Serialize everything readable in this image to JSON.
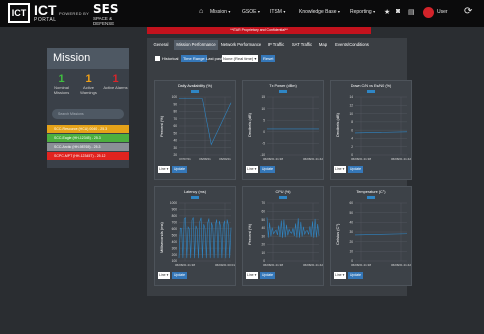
{
  "header": {
    "logo_box": "ICT",
    "logo_text": "ICT",
    "portal": "PORTAL",
    "powered_by": "POWERED BY",
    "ses": "SES",
    "ses_sub": "SPACE & DEFENSE",
    "nav": [
      "Mission",
      "GSOE",
      "ITSM",
      "Knowledge Base",
      "Reporting"
    ],
    "user": "User",
    "banner": "**ITAR Proprietary and Confidential**"
  },
  "mission": {
    "title": "Mission",
    "counts": [
      {
        "value": "1",
        "label": "Nominal Missions",
        "color": "#3fbf3f"
      },
      {
        "value": "1",
        "label": "Active Warnings",
        "color": "#f0a017"
      },
      {
        "value": "1",
        "label": "Active Alarms",
        "color": "#d9252b"
      }
    ],
    "search_placeholder": "Search Missions",
    "items": [
      {
        "label": "SCC-Resource (HCU) 0040 - 25.3",
        "color": "#e5a219"
      },
      {
        "label": "SCC-Eagle (HH-12345) - 25.3",
        "color": "#4caf3f"
      },
      {
        "label": "SCC-Arctic (HH-98765) - 25.3",
        "color": "#8a8f96"
      },
      {
        "label": "SCPC-MPT (HH-12345T) - 25.12",
        "color": "#e1231f"
      }
    ]
  },
  "tabs": [
    "General",
    "Mission Performance",
    "Network Performance",
    "IP Traffic",
    "SAT Traffic",
    "Map",
    "Events/Conditions"
  ],
  "active_tab": "Mission Performance",
  "controls": {
    "historical": "Historical",
    "time_range": "Time Range",
    "last_past": "Last past",
    "range_value": "None (Real time)",
    "reset": "Reset"
  },
  "panel_controls": {
    "select": "Line",
    "update": "Update"
  },
  "charts": [
    {
      "title": "Daily Availability (%)",
      "ylabel": "Percent (%)",
      "yticks": [
        "100",
        "90",
        "80",
        "70",
        "60",
        "50",
        "40",
        "30",
        "20"
      ],
      "xticks": [
        "07/07/21",
        "06/08/21",
        "06/09/21"
      ]
    },
    {
      "title": "Tx Power (dBm)",
      "ylabel": "Decibels (dB)",
      "yticks": [
        "15",
        "10",
        "5",
        "0",
        "-5",
        "-10"
      ],
      "xticks": [
        "06/08/21 21:38",
        "06/08/21 21:42"
      ]
    },
    {
      "title": "Down C/N vs Es/N0 (%)",
      "ylabel": "Decibels (dB)",
      "yticks": [
        "14",
        "12",
        "10",
        "8",
        "6",
        "4",
        "2",
        "0"
      ],
      "xticks": [
        "06/08/21 21:38",
        "06/08/21 21:42"
      ]
    },
    {
      "title": "Latency (ms)",
      "ylabel": "Milliseconds (ms)",
      "yticks": [
        "1000",
        "900",
        "800",
        "700",
        "600",
        "500",
        "400",
        "300",
        "200",
        "100"
      ],
      "xticks": [
        "06/08/21 21:38",
        "06/09/21 00:01"
      ]
    },
    {
      "title": "CPU (%)",
      "ylabel": "Percent (%)",
      "yticks": [
        "70",
        "60",
        "50",
        "40",
        "30",
        "20",
        "10",
        "0"
      ],
      "xticks": [
        "06/08/21 21:38",
        "06/08/21 21:42"
      ]
    },
    {
      "title": "Temperature (C°)",
      "ylabel": "Celsius (C°)",
      "yticks": [
        "60",
        "50",
        "40",
        "30",
        "20",
        "10",
        "0"
      ],
      "xticks": [
        "06/08/21 21:38",
        "06/08/21 21:42"
      ]
    }
  ],
  "colors": {
    "accent": "#3577b8",
    "line": "#2f86c5",
    "grid": "#555b62",
    "banner": "#c3121d"
  }
}
